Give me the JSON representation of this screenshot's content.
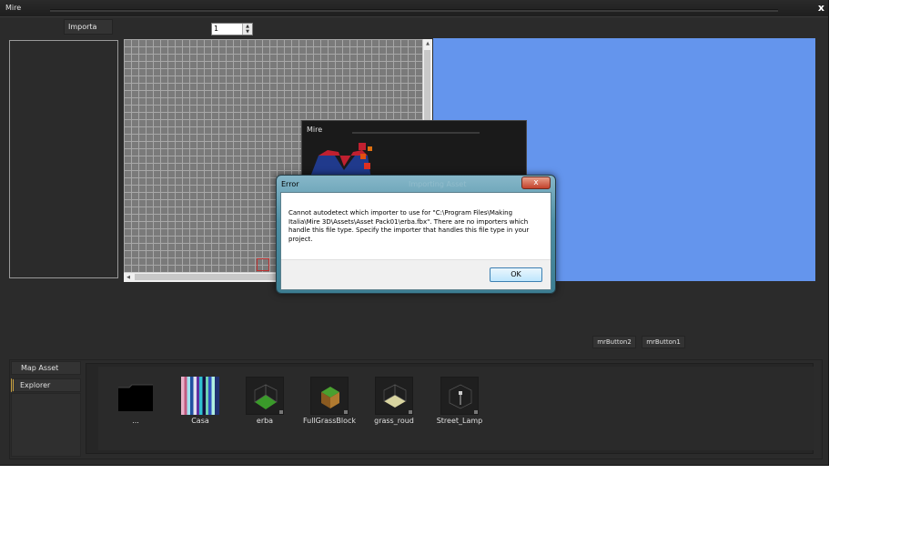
{
  "window": {
    "title": "Mire",
    "close_label": "x"
  },
  "toolbar": {
    "import_label": "Importa",
    "spinner_value": "1"
  },
  "splash": {
    "title": "Mire"
  },
  "error_dialog": {
    "title": "Error",
    "ghost_title": "Importing Asset",
    "close_label": "x",
    "message": "Cannot autodetect which importer to use for \"C:\\Program Files\\Making Italia\\Mire 3D\\Assets\\Asset Pack01\\erba.fbx\". There are no importers which handle this file type. Specify the importer that handles this file type in your project.",
    "ok_label": "OK"
  },
  "buttons": {
    "mr2": "mrButton2",
    "mr1": "mrButton1"
  },
  "sidebar": {
    "items": [
      {
        "label": "Map Asset"
      },
      {
        "label": "Explorer"
      }
    ]
  },
  "assets": [
    {
      "name": "...",
      "icon": "folder-icon"
    },
    {
      "name": "Casa",
      "icon": "texture-stripes-icon"
    },
    {
      "name": "erba",
      "icon": "grass-tile-icon"
    },
    {
      "name": "FullGrassBlock",
      "icon": "grass-block-icon"
    },
    {
      "name": "grass_roud",
      "icon": "road-tile-icon"
    },
    {
      "name": "Street_Lamp",
      "icon": "street-lamp-icon"
    }
  ],
  "colors": {
    "viewport_blue": "#6495ed",
    "app_bg": "#2b2b2b"
  }
}
